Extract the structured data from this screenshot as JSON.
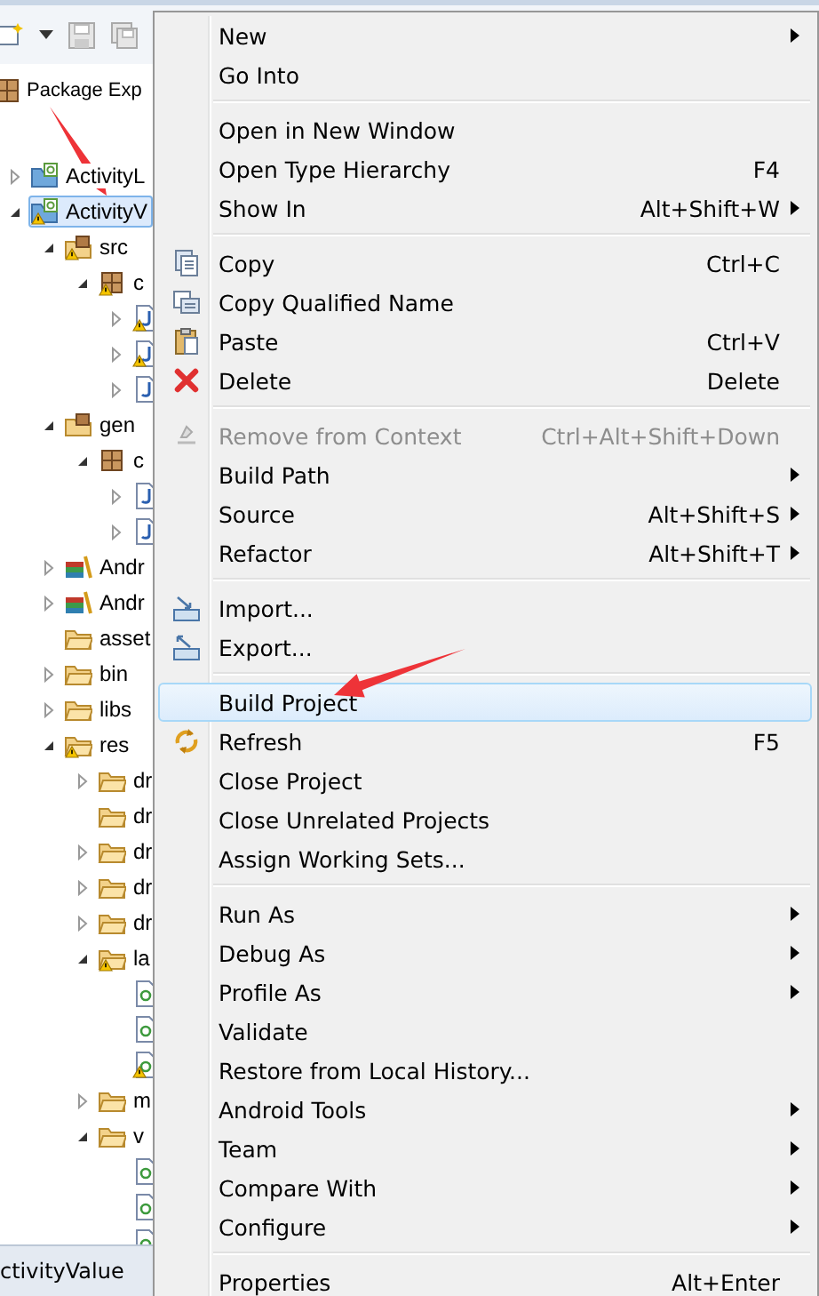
{
  "view": {
    "title": "Package Exp"
  },
  "tree": [
    {
      "label": "ActivityL",
      "kind": "project",
      "expanded": false,
      "warning": false,
      "selected": false
    },
    {
      "label": "ActivityV",
      "kind": "project",
      "expanded": true,
      "warning": true,
      "selected": true,
      "children": [
        {
          "label": "src",
          "kind": "source",
          "expanded": true,
          "warning": true,
          "selected": false,
          "children": [
            {
              "label": "c",
              "kind": "package",
              "expanded": true,
              "warning": true,
              "selected": false,
              "children": [
                {
                  "kind": "java",
                  "expanded": false,
                  "warning": true,
                  "selected": false
                },
                {
                  "kind": "java",
                  "expanded": false,
                  "warning": true,
                  "selected": false
                },
                {
                  "kind": "java",
                  "expanded": false,
                  "warning": false,
                  "selected": false
                }
              ]
            }
          ]
        },
        {
          "label": "gen",
          "kind": "source",
          "expanded": true,
          "warning": false,
          "selected": false,
          "children": [
            {
              "label": "c",
              "kind": "package",
              "expanded": true,
              "warning": false,
              "selected": false,
              "children": [
                {
                  "kind": "java",
                  "expanded": false,
                  "warning": false,
                  "selected": false
                },
                {
                  "kind": "java",
                  "expanded": false,
                  "warning": false,
                  "selected": false
                }
              ]
            }
          ]
        },
        {
          "label": "Andr",
          "kind": "library",
          "expanded": false,
          "warning": false,
          "selected": false
        },
        {
          "label": "Andr",
          "kind": "library",
          "expanded": false,
          "warning": false,
          "selected": false
        },
        {
          "label": "asset",
          "kind": "folder",
          "warning": false,
          "selected": false
        },
        {
          "label": "bin",
          "kind": "folder",
          "expanded": false,
          "warning": false,
          "selected": false
        },
        {
          "label": "libs",
          "kind": "folder",
          "expanded": false,
          "warning": false,
          "selected": false
        },
        {
          "label": "res",
          "kind": "folder",
          "expanded": true,
          "warning": true,
          "selected": false,
          "children": [
            {
              "label": "dr",
              "kind": "folder",
              "expanded": false,
              "warning": false,
              "selected": false
            },
            {
              "label": "dr",
              "kind": "folder",
              "warning": false,
              "selected": false
            },
            {
              "label": "dr",
              "kind": "folder",
              "expanded": false,
              "warning": false,
              "selected": false
            },
            {
              "label": "dr",
              "kind": "folder",
              "expanded": false,
              "warning": false,
              "selected": false
            },
            {
              "label": "dr",
              "kind": "folder",
              "expanded": false,
              "warning": false,
              "selected": false
            },
            {
              "label": "la",
              "kind": "folder",
              "expanded": true,
              "warning": true,
              "selected": false,
              "children": [
                {
                  "kind": "xml",
                  "warning": false,
                  "selected": false
                },
                {
                  "kind": "xml",
                  "warning": false,
                  "selected": false
                },
                {
                  "kind": "xml",
                  "warning": true,
                  "selected": false
                }
              ]
            },
            {
              "label": "m",
              "kind": "folder",
              "expanded": false,
              "warning": false,
              "selected": false
            },
            {
              "label": "v",
              "kind": "folder",
              "expanded": true,
              "warning": false,
              "selected": false,
              "children": [
                {
                  "kind": "xml",
                  "warning": false,
                  "selected": false
                },
                {
                  "kind": "xml",
                  "warning": false,
                  "selected": false
                },
                {
                  "kind": "xml",
                  "warning": false,
                  "selected": false
                }
              ]
            }
          ]
        }
      ]
    }
  ],
  "context_menu": {
    "groups": [
      [
        {
          "label": "New",
          "submenu": true,
          "disabled": false,
          "selected": false
        },
        {
          "label": "Go Into",
          "submenu": false,
          "disabled": false,
          "selected": false
        }
      ],
      [
        {
          "label": "Open in New Window",
          "submenu": false,
          "disabled": false,
          "selected": false
        },
        {
          "label": "Open Type Hierarchy",
          "shortcut": "F4",
          "submenu": false,
          "disabled": false,
          "selected": false
        },
        {
          "label": "Show In",
          "shortcut": "Alt+Shift+W",
          "submenu": true,
          "disabled": false,
          "selected": false
        }
      ],
      [
        {
          "label": "Copy",
          "shortcut": "Ctrl+C",
          "submenu": false,
          "disabled": false,
          "selected": false
        },
        {
          "label": "Copy Qualified Name",
          "submenu": false,
          "disabled": false,
          "selected": false
        },
        {
          "label": "Paste",
          "shortcut": "Ctrl+V",
          "submenu": false,
          "disabled": false,
          "selected": false
        },
        {
          "label": "Delete",
          "shortcut": "Delete",
          "submenu": false,
          "disabled": false,
          "selected": false
        }
      ],
      [
        {
          "label": "Remove from Context",
          "shortcut": "Ctrl+Alt+Shift+Down",
          "submenu": false,
          "disabled": true,
          "selected": false
        },
        {
          "label": "Build Path",
          "submenu": true,
          "disabled": false,
          "selected": false
        },
        {
          "label": "Source",
          "shortcut": "Alt+Shift+S",
          "submenu": true,
          "disabled": false,
          "selected": false
        },
        {
          "label": "Refactor",
          "shortcut": "Alt+Shift+T",
          "submenu": true,
          "disabled": false,
          "selected": false
        }
      ],
      [
        {
          "label": "Import...",
          "submenu": false,
          "disabled": false,
          "selected": false
        },
        {
          "label": "Export...",
          "submenu": false,
          "disabled": false,
          "selected": false
        }
      ],
      [
        {
          "label": "Build Project",
          "submenu": false,
          "disabled": false,
          "selected": true
        },
        {
          "label": "Refresh",
          "shortcut": "F5",
          "submenu": false,
          "disabled": false,
          "selected": false
        },
        {
          "label": "Close Project",
          "submenu": false,
          "disabled": false,
          "selected": false
        },
        {
          "label": "Close Unrelated Projects",
          "submenu": false,
          "disabled": false,
          "selected": false
        },
        {
          "label": "Assign Working Sets...",
          "submenu": false,
          "disabled": false,
          "selected": false
        }
      ],
      [
        {
          "label": "Run As",
          "submenu": true,
          "disabled": false,
          "selected": false
        },
        {
          "label": "Debug As",
          "submenu": true,
          "disabled": false,
          "selected": false
        },
        {
          "label": "Profile As",
          "submenu": true,
          "disabled": false,
          "selected": false
        },
        {
          "label": "Validate",
          "submenu": false,
          "disabled": false,
          "selected": false
        },
        {
          "label": "Restore from Local History...",
          "submenu": false,
          "disabled": false,
          "selected": false
        },
        {
          "label": "Android Tools",
          "submenu": true,
          "disabled": false,
          "selected": false
        },
        {
          "label": "Team",
          "submenu": true,
          "disabled": false,
          "selected": false
        },
        {
          "label": "Compare With",
          "submenu": true,
          "disabled": false,
          "selected": false
        },
        {
          "label": "Configure",
          "submenu": true,
          "disabled": false,
          "selected": false
        }
      ],
      [
        {
          "label": "Properties",
          "shortcut": "Alt+Enter",
          "submenu": false,
          "disabled": false,
          "selected": false
        }
      ]
    ]
  },
  "status_bar": {
    "text": "ctivityValue"
  }
}
